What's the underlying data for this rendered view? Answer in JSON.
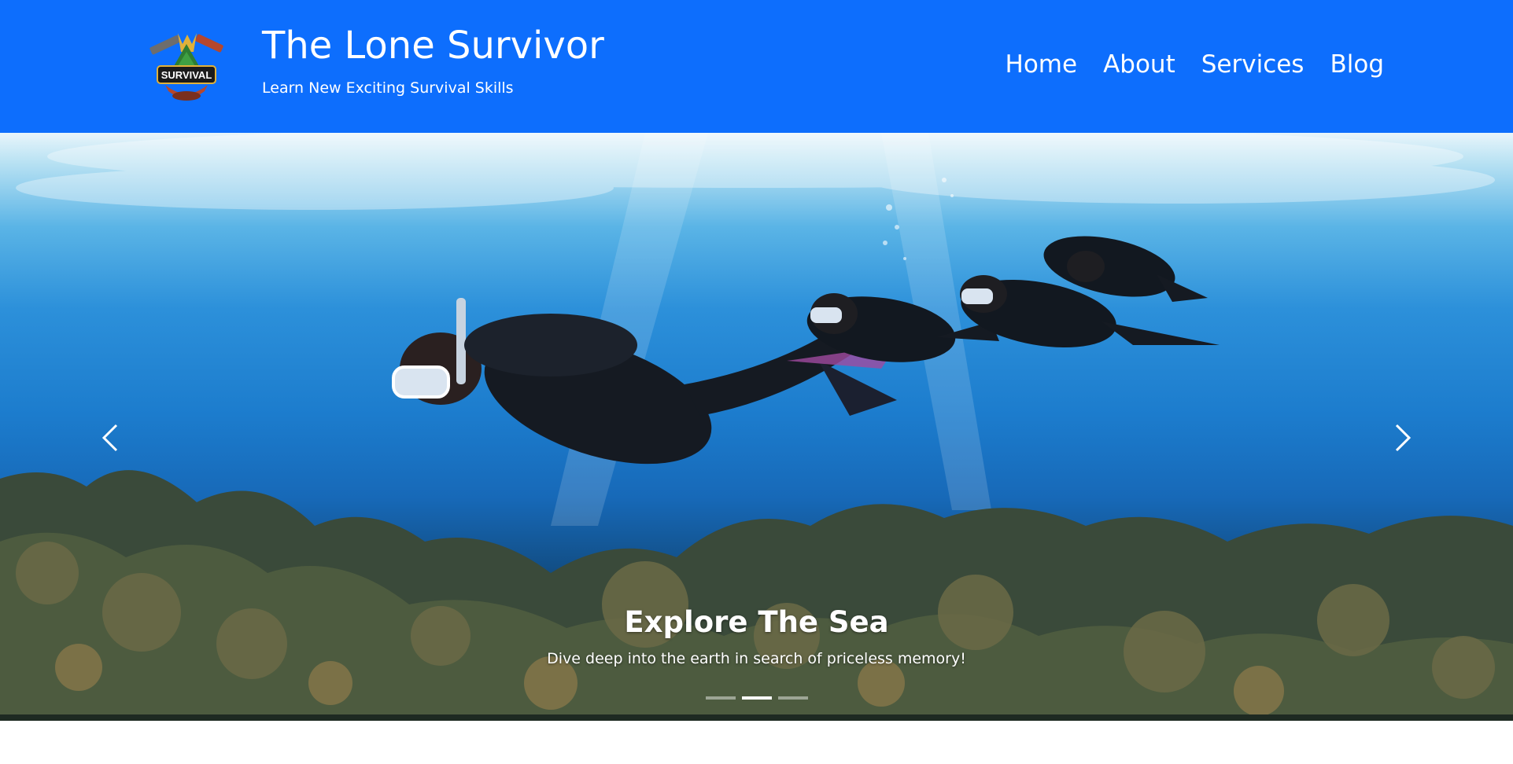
{
  "header": {
    "title": "The Lone Survivor",
    "subtitle": "Learn New Exciting Survival Skills",
    "logo_text": "SURVIVAL",
    "bg_color": "#0d6efd"
  },
  "nav": {
    "items": [
      {
        "label": "Home"
      },
      {
        "label": "About"
      },
      {
        "label": "Services"
      },
      {
        "label": "Blog"
      }
    ]
  },
  "carousel": {
    "caption_title": "Explore The Sea",
    "caption_text": "Dive deep into the earth in search of priceless memory!",
    "slide_count": 3,
    "active_index": 1,
    "prev_icon": "chevron-left-icon",
    "next_icon": "chevron-right-icon"
  }
}
